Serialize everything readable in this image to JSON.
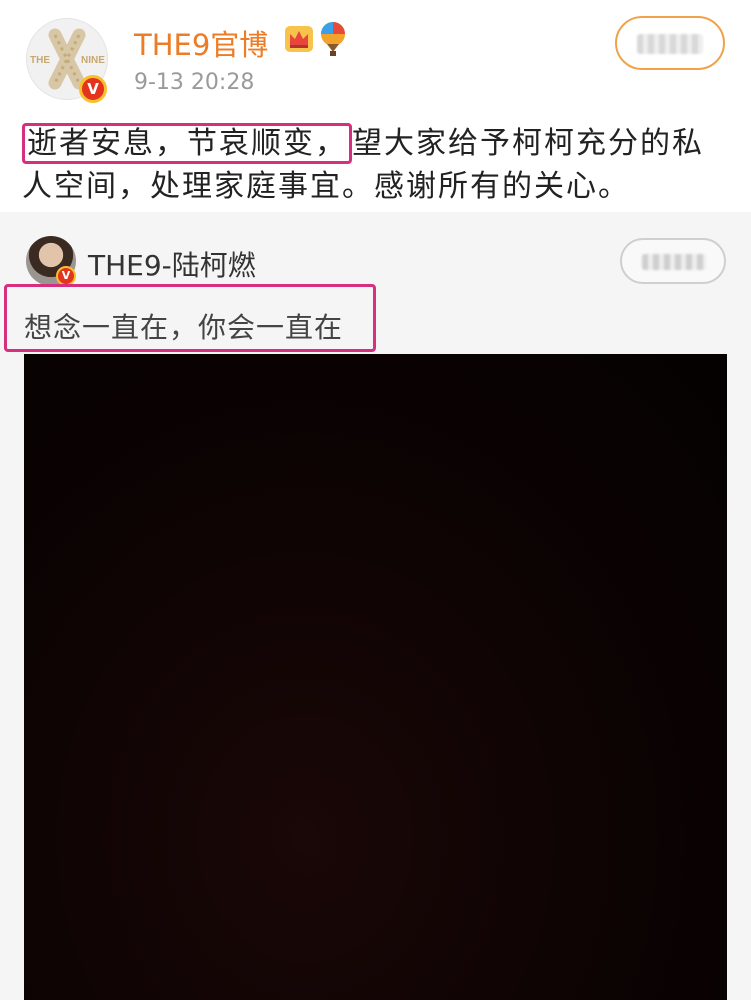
{
  "post": {
    "author": "THE9官博",
    "time": "9-13 20:28",
    "verified_badge": "V",
    "text_highlight": "逝者安息，节哀顺变，",
    "text_rest": "望大家给予柯柯充分的私人空间，处理家庭事宜。感谢所有的关心。"
  },
  "repost": {
    "author": "THE9-陆柯燃",
    "verified_badge": "V",
    "text": "想念一直在，你会一直在"
  },
  "icons": [
    "crown-icon",
    "balloon-icon",
    "verified-icon",
    "avatar"
  ],
  "colors": {
    "author_name": "#ec7c25",
    "highlight_border": "#d52f7e",
    "follow_border": "#f0a24a",
    "card_background": "#f5f5f5",
    "image_background": "#0c0303"
  }
}
